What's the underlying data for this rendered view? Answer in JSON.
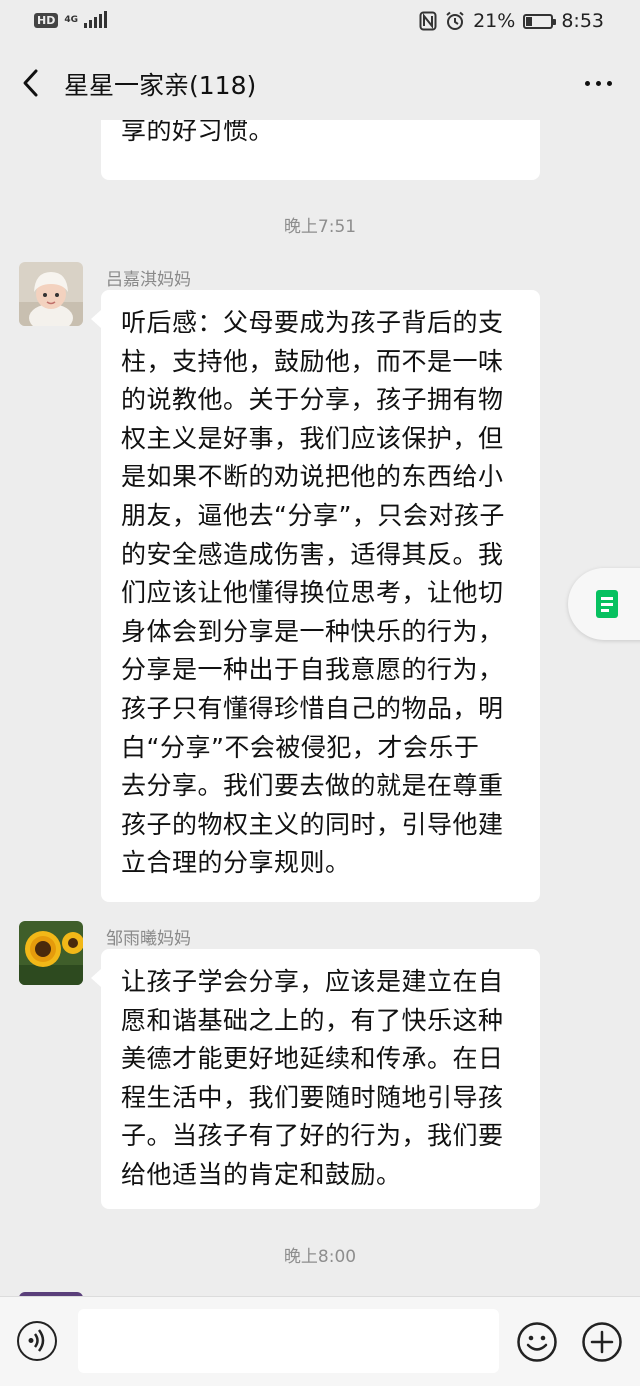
{
  "status_bar": {
    "hd": "HD",
    "network": "4G",
    "battery_percent": "21%",
    "battery_level": 0.21,
    "time": "8:53"
  },
  "nav": {
    "title": "星星一家亲(118)",
    "back_icon": "chevron-left-icon",
    "more_icon": "more-dots-icon"
  },
  "messages": [
    {
      "type": "text",
      "partial": true,
      "lines": [
        "享的好习惯。"
      ]
    },
    {
      "type": "timestamp",
      "text": "晚上7:51"
    },
    {
      "type": "text",
      "sender": "吕嘉淇妈妈",
      "avatar": "baby-avatar",
      "lines": [
        "听后感：父母要成为孩子背后的支",
        "柱，支持他，鼓励他，而不是一味",
        "的说教他。关于分享，孩子拥有物",
        "权主义是好事，我们应该保护，但",
        "是如果不断的劝说把他的东西给小",
        "朋友，逼他去“分享”，只会对孩子",
        "的安全感造成伤害，适得其反。我",
        "们应该让他懂得换位思考，让他切",
        "身体会到分享是一种快乐的行为，",
        "分享是一种出于自我意愿的行为，",
        "孩子只有懂得珍惜自己的物品，明",
        "白“分享”不会被侵犯，才会乐于",
        "去分享。我们要去做的就是在尊重",
        "孩子的物权主义的同时，引导他建",
        "立合理的分享规则。"
      ]
    },
    {
      "type": "text",
      "sender": "邹雨曦妈妈",
      "avatar": "sunflower-avatar",
      "lines": [
        "让孩子学会分享，应该是建立在自",
        "愿和谐基础之上的，有了快乐这种",
        "美德才能更好地延续和传承。在日",
        "程生活中，我们要随时随地引导孩",
        "子。当孩子有了好的行为，我们要",
        "给他适当的肯定和鼓励。"
      ]
    },
    {
      "type": "timestamp",
      "text": "晚上8:00"
    }
  ],
  "side_tab": {
    "icon": "document-icon"
  },
  "input_bar": {
    "voice_icon": "voice-icon",
    "placeholder": "",
    "emoji_icon": "emoji-icon",
    "plus_icon": "plus-icon"
  },
  "colors": {
    "background": "#ededed",
    "bubble": "#ffffff",
    "accent": "#07c160"
  }
}
